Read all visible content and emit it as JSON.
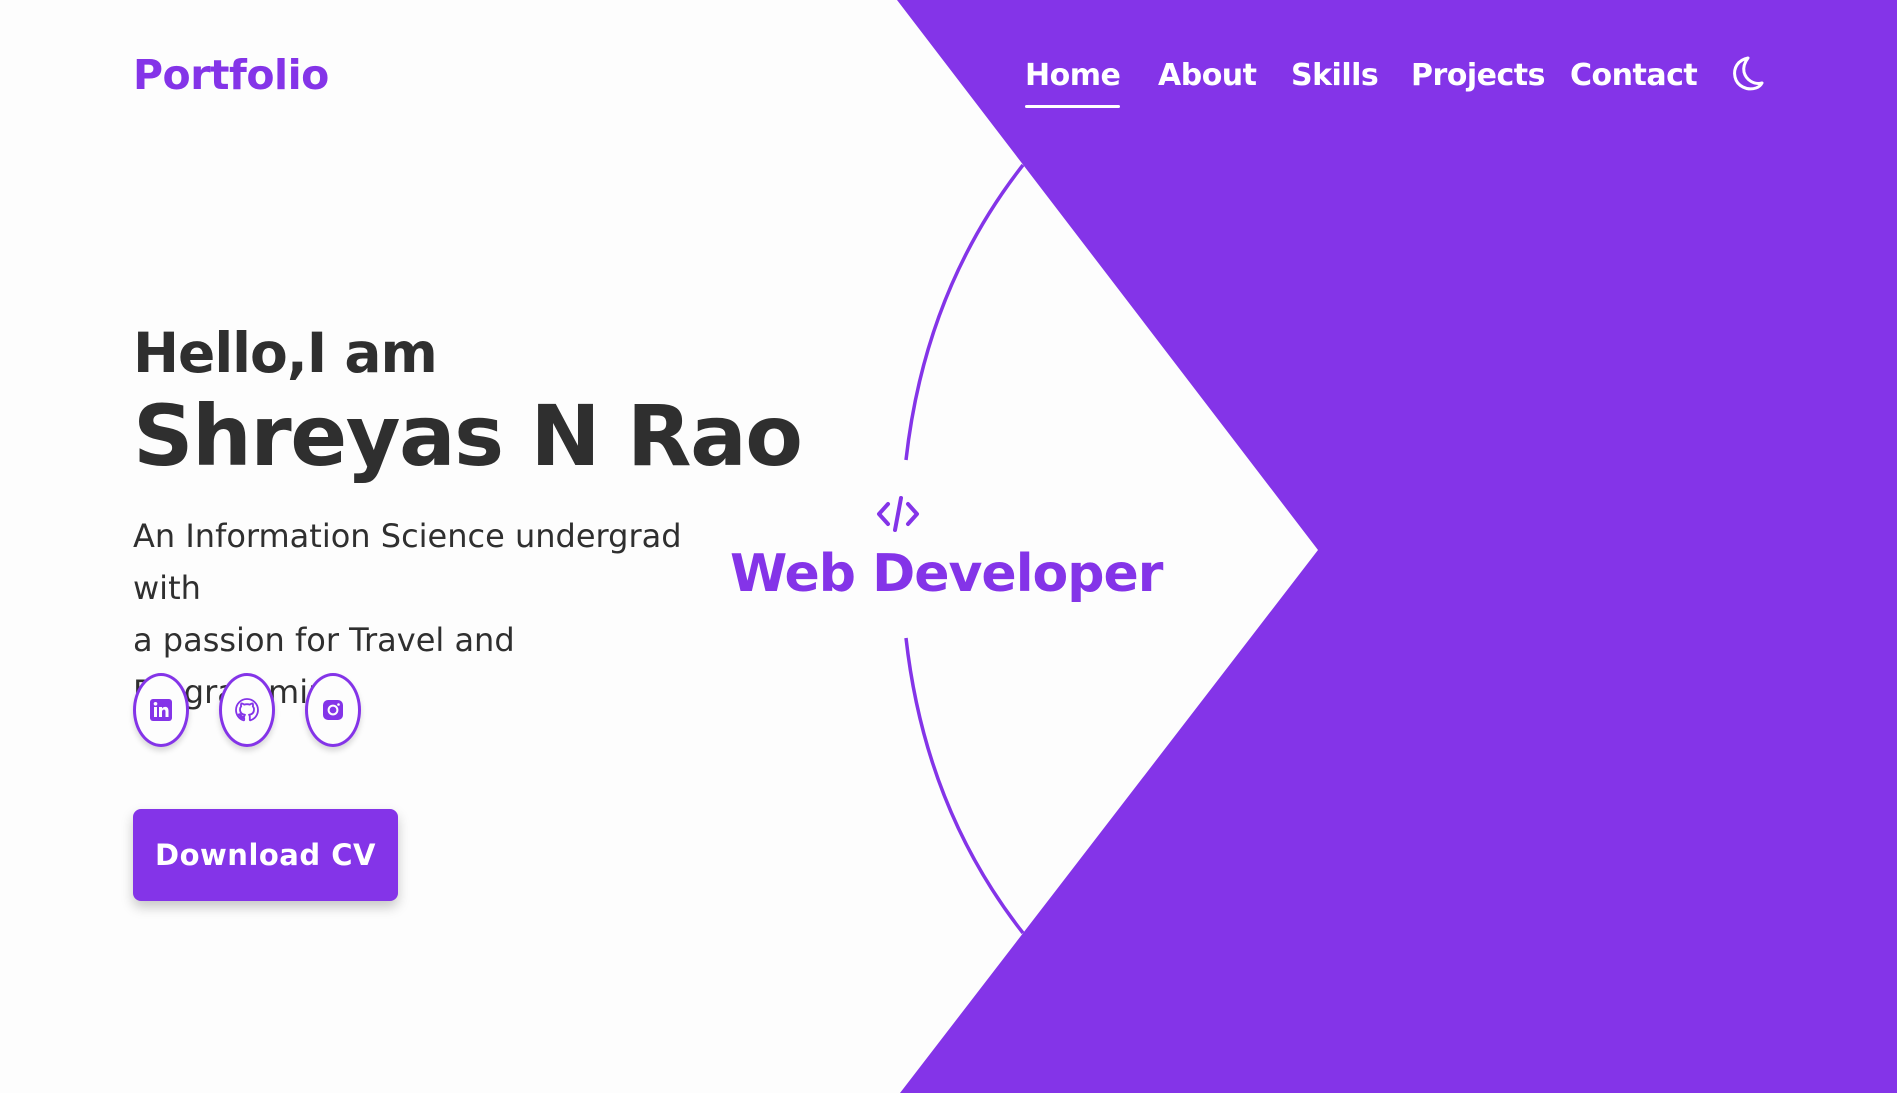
{
  "colors": {
    "accent": "#8434e8",
    "text_dark": "#2f2f2f",
    "background": "#fdfdfd",
    "white": "#ffffff"
  },
  "header": {
    "logo": "Portfolio",
    "nav": [
      {
        "label": "Home",
        "active": true
      },
      {
        "label": "About",
        "active": false
      },
      {
        "label": "Skills",
        "active": false
      },
      {
        "label": "Projects",
        "active": false
      },
      {
        "label": "Contact",
        "active": false
      }
    ],
    "theme_toggle_icon": "moon-icon"
  },
  "hero": {
    "greeting": "Hello,I am",
    "name": "Shreyas N Rao",
    "description_line1": "An Information Science undergrad with",
    "description_line2": "a passion for Travel and Programming.",
    "socials": [
      {
        "icon": "linkedin-icon"
      },
      {
        "icon": "github-icon"
      },
      {
        "icon": "instagram-icon"
      }
    ],
    "cv_button": "Download CV"
  },
  "role": {
    "icon": "code-icon",
    "title": "Web Developer"
  }
}
